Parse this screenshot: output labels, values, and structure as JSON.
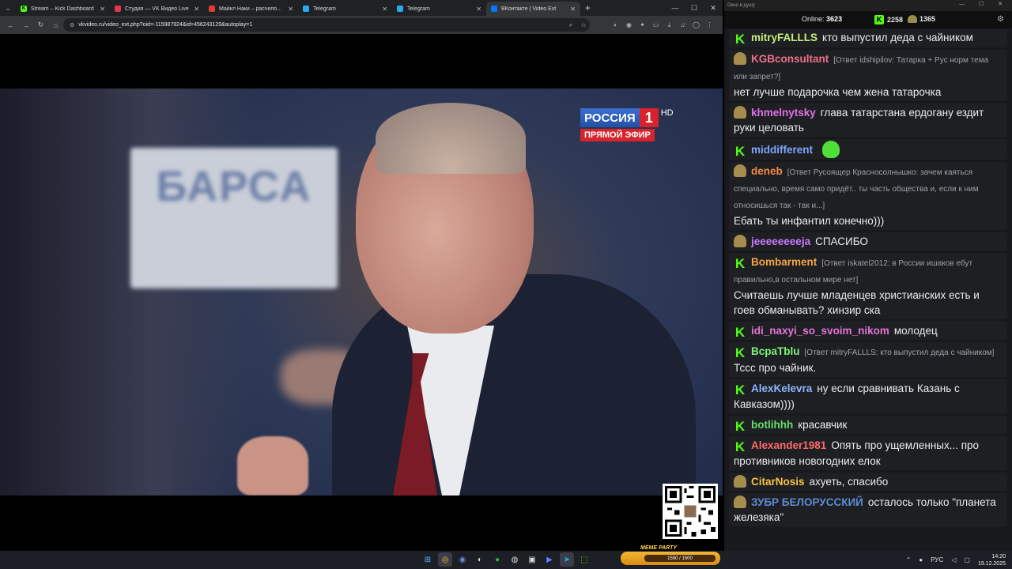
{
  "browser": {
    "tabs": [
      {
        "title": "Stream – Kick Dashboard",
        "fav": "K",
        "color": "#53fc18"
      },
      {
        "title": "Студия — VK Видео Live",
        "fav": "",
        "color": "#e8354a"
      },
      {
        "title": "Майкл Наки – расчеловечива...",
        "fav": "",
        "color": "#e53935"
      },
      {
        "title": "Telegram",
        "fav": "",
        "color": "#2aabee"
      },
      {
        "title": "Telegram",
        "fav": "",
        "color": "#2aabee"
      },
      {
        "title": "ВКонтакте | Video Ext",
        "fav": "",
        "color": "#0077ff"
      }
    ],
    "url": "vkvideo.ru/video_ext.php?oid=-115987924&id=456243129&autoplay=1"
  },
  "video": {
    "channel_name": "РОССИЯ",
    "channel_number": "1",
    "channel_hd": "HD",
    "live_label": "ПРЯМОЙ ЭФИР",
    "sign_text": "БАРСА"
  },
  "chat": {
    "window_title": "Окно в душу",
    "online_label": "Online:",
    "online_count": "3623",
    "kick_count": "2258",
    "twitch_count": "1365",
    "accent_kick": "#53fc18",
    "messages": [
      {
        "platform": "kick",
        "nick": "mitryFALLLS",
        "color": "#c3ef7d",
        "reply": "",
        "text": "кто выпустил деда с чайником"
      },
      {
        "platform": "twitch",
        "nick": "KGBconsultant",
        "color": "#f0708a",
        "reply": "[Ответ idshipilov: Татарка + Рус норм тема или запрет?]",
        "text": "нет лучше подарочка чем жена татарочка"
      },
      {
        "platform": "twitch",
        "nick": "khmelnytsky",
        "color": "#e072e8",
        "reply": "",
        "text": "глава татарстана ердогану ездит руки целовать"
      },
      {
        "platform": "kick",
        "nick": "middifferent",
        "color": "#7fa6ff",
        "reply": "",
        "text": ""
      },
      {
        "platform": "twitch",
        "nick": "deneb",
        "color": "#f08a4b",
        "reply": "[Ответ Русоящер Красносолнышко: зачем каяться специально, время само придёт.. ты часть общества и, если к ним относишься так - так и...]",
        "text": "Ебать ты инфантил конечно)))"
      },
      {
        "platform": "twitch",
        "nick": "jeeeeeeeeja",
        "color": "#c97bff",
        "reply": "",
        "text": "СПАСИБО"
      },
      {
        "platform": "kick",
        "nick": "Bombarment",
        "color": "#f5a742",
        "reply": "[Ответ iskatel2012: в России ишаков ебут правильно,в остальном мире нет]",
        "text": "Считаешь лучше младенцев христианских есть и гоев обманывать? хинзир ска"
      },
      {
        "platform": "kick",
        "nick": "idi_naxyi_so_svoim_nikom",
        "color": "#e774d8",
        "reply": "",
        "text": "молодец"
      },
      {
        "platform": "kick",
        "nick": "BcpaTblu",
        "color": "#7ef57b",
        "reply": "[Ответ mitryFALLLS: кто выпустил деда с чайником]",
        "text": "Тссс про чайник."
      },
      {
        "platform": "kick",
        "nick": "AlexKelevra",
        "color": "#8fb4ff",
        "reply": "",
        "text": "ну если сравнивать Казань с Кавказом))))"
      },
      {
        "platform": "kick",
        "nick": "botlihhh",
        "color": "#66e066",
        "reply": "",
        "text": "красавчик"
      },
      {
        "platform": "kick",
        "nick": "Alexander1981",
        "color": "#ff6b6b",
        "reply": "",
        "text": "Опять про ущемленных... про противников новогодних елок"
      },
      {
        "platform": "twitch",
        "nick": "CitarNosis",
        "color": "#f5c542",
        "reply": "",
        "text": "ахуеть, спасибо"
      },
      {
        "platform": "twitch",
        "nick": "ЗУБР БЕЛОРУССКИЙ",
        "color": "#5c8cd6",
        "reply": "",
        "text": "осталось только \"планета железяка\""
      }
    ]
  },
  "taskbar": {
    "meme_label": "MEME PARTY",
    "meme_progress": "1550 / 1500",
    "lang": "РУС",
    "time": "14:20",
    "date": "19.12.2025"
  }
}
